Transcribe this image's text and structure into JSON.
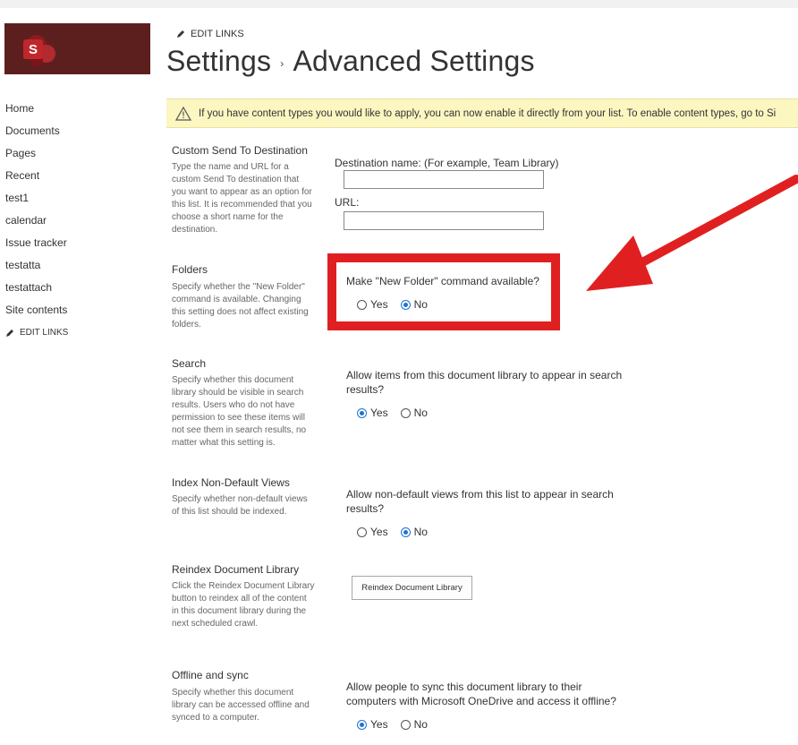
{
  "nav": {
    "items": [
      "Home",
      "Documents",
      "Pages",
      "Recent",
      "test1",
      "calendar",
      "Issue tracker",
      "testatta",
      "testattach",
      "Site contents"
    ],
    "edit_links": "EDIT LINKS"
  },
  "header": {
    "edit_links": "EDIT LINKS",
    "breadcrumb_parent": "Settings",
    "separator": "›",
    "title": "Advanced Settings"
  },
  "banner": {
    "text": "If you have content types you would like to apply, you can now enable it directly from your list. To enable content types, go to Si"
  },
  "sections": {
    "send_to": {
      "title": "Custom Send To Destination",
      "desc": "Type the name and URL for a custom Send To destination that you want to appear as an option for this list. It is recommended that you choose a short name for the destination.",
      "dest_label": "Destination name: (For example, Team Library)",
      "dest_value": "",
      "url_label": "URL:",
      "url_value": ""
    },
    "folders": {
      "title": "Folders",
      "desc": "Specify whether the \"New Folder\" command is available. Changing this setting does not affect existing folders.",
      "question": "Make \"New Folder\" command available?",
      "yes": "Yes",
      "no": "No",
      "selected": "No"
    },
    "search": {
      "title": "Search",
      "desc": "Specify whether this document library should be visible in search results. Users who do not have permission to see these items will not see them in search results, no matter what this setting is.",
      "question": "Allow items from this document library to appear in search results?",
      "yes": "Yes",
      "no": "No",
      "selected": "Yes"
    },
    "index": {
      "title": "Index Non-Default Views",
      "desc": "Specify whether non-default views of this list should be indexed.",
      "question": "Allow non-default views from this list to appear in search results?",
      "yes": "Yes",
      "no": "No",
      "selected": "No"
    },
    "reindex": {
      "title": "Reindex Document Library",
      "desc": "Click the Reindex Document Library button to reindex all of the content in this document library during the next scheduled crawl.",
      "button": "Reindex Document Library"
    },
    "offline": {
      "title": "Offline and sync",
      "desc": "Specify whether this document library can be accessed offline and synced to a computer.",
      "question": "Allow people to sync this document library to their computers with Microsoft OneDrive and access it offline?",
      "yes": "Yes",
      "no": "No",
      "selected": "Yes"
    }
  },
  "colors": {
    "logo_bg": "#5c1f1e",
    "banner_bg": "#fcf6c1",
    "highlight": "#e02020",
    "radio_selected": "#1e73d2"
  }
}
